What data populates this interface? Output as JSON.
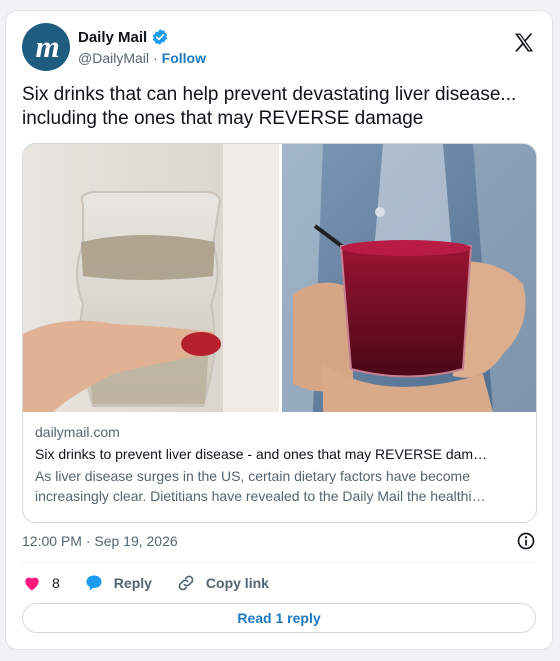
{
  "account": {
    "avatar_text": "m",
    "display_name": "Daily Mail",
    "handle": "@DailyMail",
    "separator": "·",
    "follow_label": "Follow"
  },
  "tweet": {
    "text": "Six drinks that can help prevent devastating liver disease... including the ones that may REVERSE damage"
  },
  "link_card": {
    "domain": "dailymail.com",
    "title": "Six drinks to prevent liver disease - and ones that may REVERSE dam…",
    "description": "As liver disease surges in the US, certain dietary factors have become increasingly clear. Dietitians have revealed to the Daily Mail the healthi…"
  },
  "timestamp": "12:00 PM · Sep 19, 2026",
  "actions": {
    "like_count": "8",
    "reply_label": "Reply",
    "copy_link_label": "Copy link"
  },
  "read_replies_label": "Read 1 reply",
  "colors": {
    "accent": "#1d78c1",
    "avatar_bg": "#1f5d80",
    "heart": "#f91880",
    "muted_text": "#536471"
  }
}
